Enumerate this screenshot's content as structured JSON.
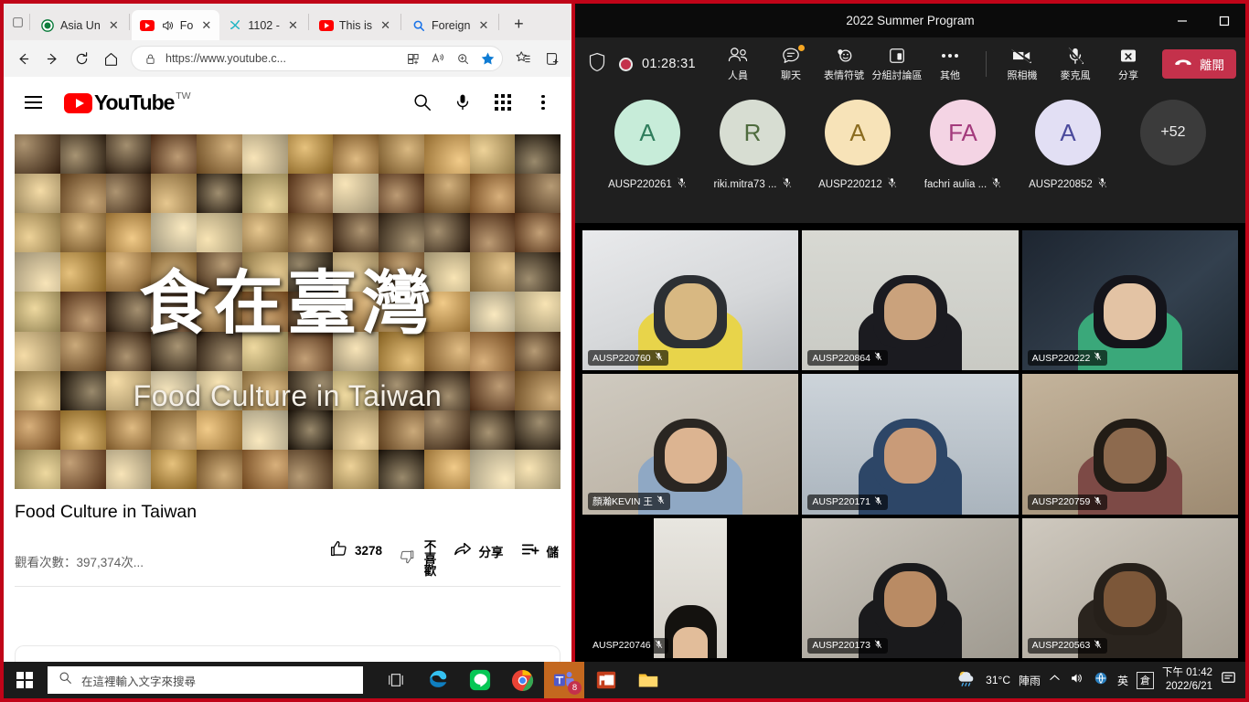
{
  "browser": {
    "tabs": [
      {
        "title": "Asia Un",
        "favicon": "asia-university-icon",
        "active": false
      },
      {
        "title": "Fo",
        "favicon": "youtube-icon",
        "active": true,
        "audio": true
      },
      {
        "title": "1102 -",
        "favicon": "canva-icon",
        "active": false
      },
      {
        "title": "This is",
        "favicon": "youtube-icon",
        "active": false
      },
      {
        "title": "Foreign",
        "favicon": "search-icon",
        "active": false
      }
    ],
    "new_tab_label": "+",
    "address": {
      "url": "https://www.youtube.c...",
      "lock_icon": "lock-icon"
    },
    "nav_icons": [
      "back-icon",
      "forward-icon",
      "refresh-icon",
      "home-icon"
    ],
    "omnibox_icons": [
      "split-screen-icon",
      "read-aloud-icon",
      "zoom-icon",
      "favorite-star-icon"
    ],
    "toolbar_icons": [
      "favorites-list-icon",
      "collections-icon"
    ],
    "accent_star_color": "#0f7cd4"
  },
  "youtube": {
    "logo_text": "YouTube",
    "country_code": "TW",
    "header_icons": [
      "search-icon",
      "microphone-icon",
      "apps-grid-icon",
      "more-vertical-icon"
    ],
    "video": {
      "overlay_title_cn": "食在臺灣",
      "overlay_title_en": "Food Culture in Taiwan"
    },
    "title": "Food Culture in Taiwan",
    "views": "觀看次數：397,374次...",
    "actions": {
      "like_count": "3278",
      "dislike_label": "不喜歡",
      "share_label": "分享",
      "save_label": "儲"
    }
  },
  "teams": {
    "window_title": "2022 Summer Program",
    "window_buttons": [
      "minimize-button",
      "maximize-button"
    ],
    "toolbar": {
      "timer": "01:28:31",
      "shield_icon": "shield-icon",
      "record_icon": "record-icon",
      "items": [
        {
          "label": "人員",
          "icon": "people-icon",
          "badge": false
        },
        {
          "label": "聊天",
          "icon": "chat-icon",
          "badge": true
        },
        {
          "label": "表情符號",
          "icon": "reactions-icon",
          "badge": false
        },
        {
          "label": "分組討論區",
          "icon": "breakout-rooms-icon",
          "badge": false
        },
        {
          "label": "其他",
          "icon": "more-horizontal-icon",
          "badge": false
        }
      ],
      "media": [
        {
          "label": "照相機",
          "icon": "camera-off-icon"
        },
        {
          "label": "麥克風",
          "icon": "microphone-off-icon"
        },
        {
          "label": "分享",
          "icon": "share-screen-icon"
        }
      ],
      "leave_label": "離開",
      "leave_color": "#c4314b"
    },
    "roster": [
      {
        "initials": "A",
        "name": "AUSP220261",
        "bg": "#c7ecd9",
        "fg": "#2f7d5c",
        "muted": true
      },
      {
        "initials": "R",
        "name": "riki.mitra73 ...",
        "bg": "#d7ddd2",
        "fg": "#4e6b3e",
        "muted": true
      },
      {
        "initials": "A",
        "name": "AUSP220212",
        "bg": "#f7e3b8",
        "fg": "#8a6b1f",
        "muted": true
      },
      {
        "initials": "FA",
        "name": "fachri aulia ...",
        "bg": "#f4d4e4",
        "fg": "#a33a7c",
        "muted": true
      },
      {
        "initials": "A",
        "name": "AUSP220852",
        "bg": "#e2dff4",
        "fg": "#4b4a9c",
        "muted": true
      }
    ],
    "roster_overflow": "+52",
    "tiles": [
      {
        "name": "AUSP220760",
        "muted": true
      },
      {
        "name": "AUSP220864",
        "muted": true
      },
      {
        "name": "AUSP220222",
        "muted": true
      },
      {
        "name": "顏瀚KEVIN 王",
        "muted": true
      },
      {
        "name": "AUSP220171",
        "muted": true
      },
      {
        "name": "AUSP220759",
        "muted": true
      },
      {
        "name": "AUSP220746",
        "muted": true
      },
      {
        "name": "AUSP220173",
        "muted": true
      },
      {
        "name": "AUSP220563",
        "muted": true
      }
    ]
  },
  "taskbar": {
    "start_icon": "windows-start-icon",
    "search_placeholder": "在這裡輸入文字來搜尋",
    "search_icon": "search-icon",
    "apps": [
      {
        "name": "task-view-icon",
        "active": false
      },
      {
        "name": "edge-icon",
        "active": false
      },
      {
        "name": "line-icon",
        "active": false
      },
      {
        "name": "chrome-icon",
        "active": false
      },
      {
        "name": "teams-icon",
        "active": true,
        "badge": "8"
      },
      {
        "name": "powerpoint-icon",
        "active": false
      },
      {
        "name": "file-explorer-icon",
        "active": false
      }
    ],
    "tray": {
      "weather_icon": "weather-rain-icon",
      "temperature": "31°C",
      "weather_text": "陣雨",
      "chevron_icon": "chevron-up-icon",
      "volume_icon": "volume-icon",
      "network_icon": "network-icon",
      "ime_lang": "英",
      "ime_mode": "倉",
      "time": "下午 01:42",
      "date": "2022/6/21",
      "notification_icon": "notifications-icon"
    }
  }
}
